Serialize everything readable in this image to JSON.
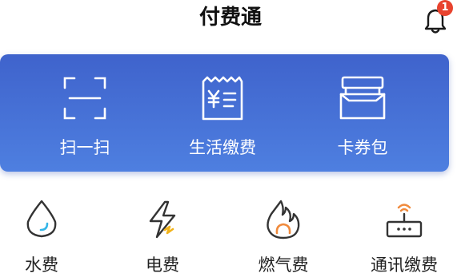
{
  "header": {
    "title": "付费通",
    "bell_icon": "bell-icon",
    "notification_count": "1"
  },
  "colors": {
    "card_gradient_top": "#3f63cc",
    "card_gradient_bottom": "#4e7fe0",
    "badge": "#e8432e",
    "water_accent": "#35b6e8",
    "electric_accent": "#f2b319",
    "gas_accent": "#f08a3c"
  },
  "quick_actions": [
    {
      "label": "扫一扫",
      "icon": "scan-icon"
    },
    {
      "label": "生活缴费",
      "icon": "bill-icon"
    },
    {
      "label": "卡券包",
      "icon": "wallet-icon"
    }
  ],
  "services": [
    {
      "label": "水费",
      "icon": "water-drop-icon"
    },
    {
      "label": "电费",
      "icon": "lightning-icon"
    },
    {
      "label": "燃气费",
      "icon": "flame-icon"
    },
    {
      "label": "通讯缴费",
      "icon": "router-icon"
    }
  ]
}
